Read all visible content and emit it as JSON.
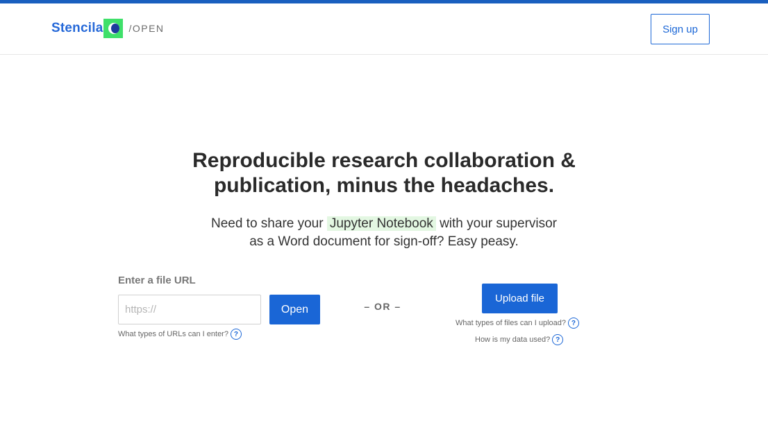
{
  "header": {
    "brand_name": "Stencila",
    "brand_suffix": "/OPEN",
    "signup_label": "Sign up"
  },
  "hero": {
    "headline_line1": "Reproducible research collaboration &",
    "headline_line2": "publication, minus the headaches.",
    "sub_before": "Need to share your",
    "sub_highlight": "Jupyter Notebook",
    "sub_after": "with your supervisor",
    "sub_line2": "as a Word document for sign-off? Easy peasy."
  },
  "url_form": {
    "label": "Enter a file URL",
    "placeholder": "https://",
    "value": "",
    "open_label": "Open",
    "help_text": "What types of URLs can I enter?"
  },
  "separator": "– OR –",
  "upload": {
    "button_label": "Upload file",
    "files_help": "What types of files can I upload?",
    "data_help": "How is my data used?"
  },
  "icons": {
    "help": "question-circle-icon",
    "logo": "stencila-logo-icon"
  },
  "colors": {
    "accent": "#1a66d6",
    "top_strip": "#1a5fbf",
    "brand_text": "#2568d8",
    "logo_green": "#3fe06a",
    "highlight": "#e3f7e2"
  },
  "help_glyph": "?"
}
